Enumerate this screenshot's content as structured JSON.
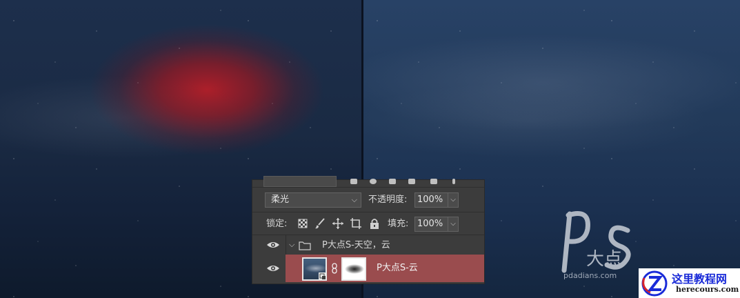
{
  "panel": {
    "blend_mode": "柔光",
    "opacity_label": "不透明度:",
    "opacity_value": "100%",
    "lock_label": "锁定:",
    "fill_label": "填充:",
    "fill_value": "100%"
  },
  "layers": {
    "group_name": "P大点S-天空，云",
    "layer_name": "P大点S-云",
    "selected_color": "#9a4c4e"
  },
  "watermark": {
    "site": "pdadians.com",
    "logo_cn": "大点"
  },
  "badge": {
    "title": "这里教程网",
    "url": "herecours.com"
  },
  "icons": [
    "eye-icon",
    "folder-icon",
    "chevron-down-icon",
    "link-icon",
    "lock-transparency-icon",
    "brush-icon",
    "move-icon",
    "artboard-icon",
    "lock-icon"
  ]
}
